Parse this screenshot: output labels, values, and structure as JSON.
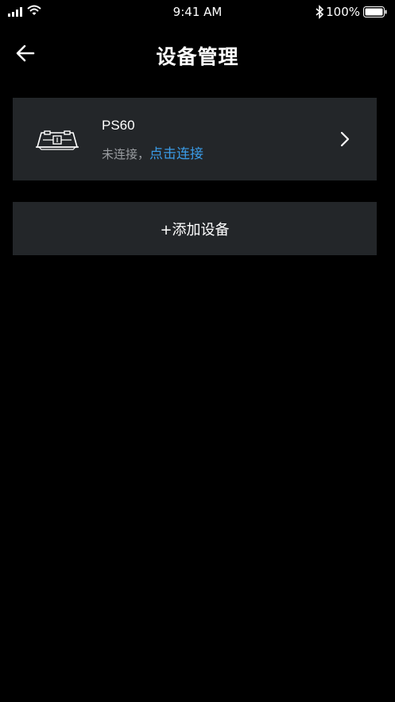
{
  "status_bar": {
    "time": "9:41 AM",
    "battery_percent": "100%",
    "icons": [
      "cellular-signal-icon",
      "wifi-icon",
      "bluetooth-icon",
      "battery-icon"
    ]
  },
  "header": {
    "title": "设备管理",
    "back_icon": "arrow-left-icon"
  },
  "devices": [
    {
      "name": "PS60",
      "status_text": "未连接，",
      "action_text": "点击连接",
      "icon": "keyboard-device-icon"
    }
  ],
  "add_device": {
    "label": "+添加设备"
  },
  "colors": {
    "background": "#000000",
    "card": "#232629",
    "link": "#3a9be6",
    "muted_text": "#9a9da1"
  }
}
